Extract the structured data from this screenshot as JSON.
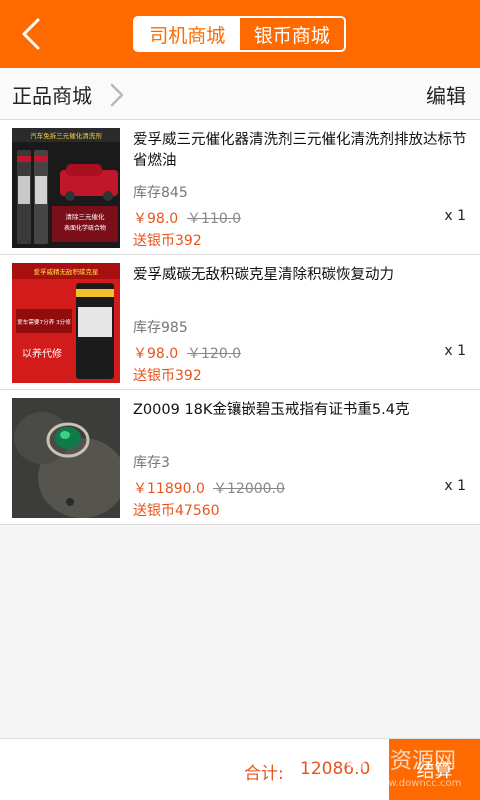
{
  "theme": {
    "accent": "#fe6a00",
    "price_color": "#e8541e"
  },
  "topbar": {
    "back_icon": "chevron-left-icon",
    "tabs": [
      {
        "label": "司机商城",
        "active": true
      },
      {
        "label": "银币商城",
        "active": false
      }
    ]
  },
  "header": {
    "title": "正品商城",
    "edit_label": "编辑"
  },
  "items": [
    {
      "title": "爱孚威三元催化器清洗剂三元催化清洗剂排放达标节省燃油",
      "stock": "库存845",
      "price": "￥98.0",
      "old_price": "￥110.0",
      "coin": "送银币392",
      "qty": "x 1",
      "thumb_text": [
        "汽车免拆三元催化清洗剂",
        "清除三元催化",
        "表面化学硫合物"
      ]
    },
    {
      "title": "爱孚威碳无敌积碳克星清除积碳恢复动力",
      "stock": "库存985",
      "price": "￥98.0",
      "old_price": "￥120.0",
      "coin": "送银币392",
      "qty": "x 1",
      "thumb_text": [
        "爱孚威精无敌积碳克星",
        "爱车需要7分养 3分修",
        "以养代修"
      ]
    },
    {
      "title": "Z0009 18K金镶嵌碧玉戒指有证书重5.4克",
      "stock": "库存3",
      "price": "￥11890.0",
      "old_price": "￥12000.0",
      "coin": "送银币47560",
      "qty": "x 1",
      "thumb_text": []
    }
  ],
  "footer": {
    "total_label": "合计:",
    "total_value": "12086.0",
    "checkout_label": "结算"
  },
  "watermark": {
    "text": "绿色资源网",
    "url": "www.downcc.com"
  }
}
